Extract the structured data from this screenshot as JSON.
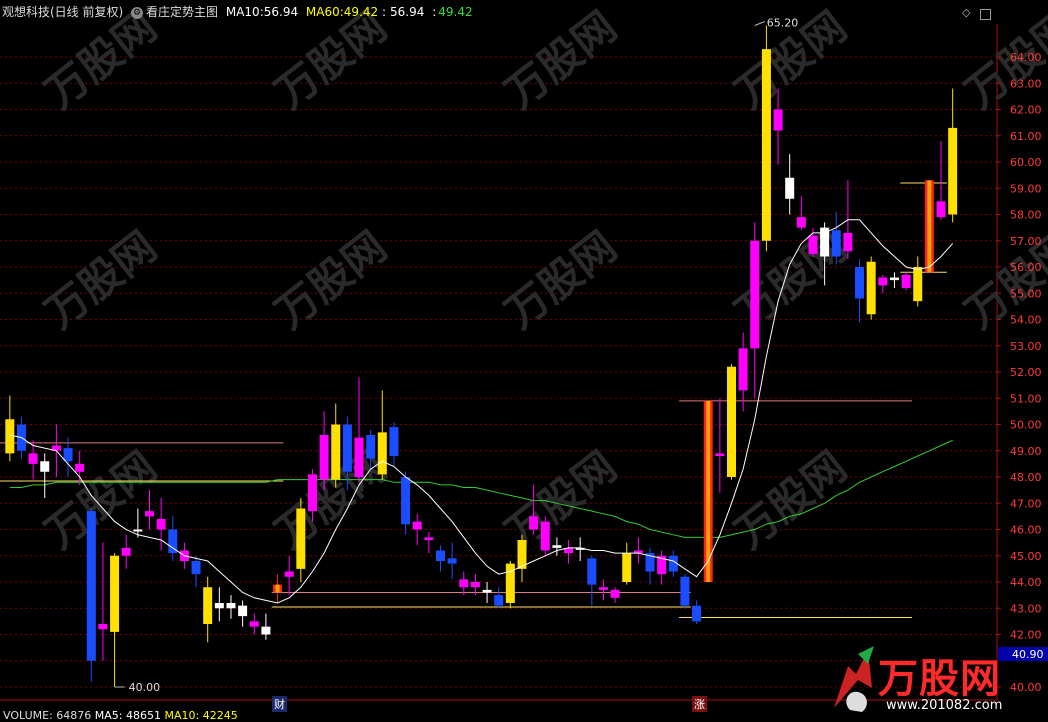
{
  "header": {
    "stock_name": "观想科技(日线 前复权)",
    "indicator_name": "看庄定势主图",
    "ma10_label": "MA10:",
    "ma10_value": "56.94",
    "ma60_label": "MA60:",
    "ma60_value": "49.42",
    "sep": ":",
    "extra_value_1": "56.94",
    "extra_value_2": "49.42"
  },
  "volume_bar": {
    "label": "VOLUME: 64876",
    "ma5": "MA5: 48651",
    "ma10": "MA10: 42245"
  },
  "markers": {
    "cai": "财",
    "zhang": "涨"
  },
  "price_labels": {
    "high": "65.20",
    "low": "40.00",
    "current": "40.90"
  },
  "watermark": {
    "brand": "万股网",
    "url": "www.201082.com"
  },
  "colors": {
    "up": "#ffe000",
    "down": "#1a4dff",
    "pink": "#ff00ff",
    "white": "#ffffff",
    "red": "#ff2020",
    "ma10": "#ffffff",
    "ma60": "#33cc33",
    "grid": "#7a0000"
  },
  "chart_data": {
    "type": "candlestick",
    "ylim": [
      40.0,
      65.2
    ],
    "yticks": [
      40.0,
      41.0,
      42.0,
      43.0,
      44.0,
      45.0,
      46.0,
      47.0,
      48.0,
      49.0,
      50.0,
      51.0,
      52.0,
      53.0,
      54.0,
      55.0,
      56.0,
      57.0,
      58.0,
      59.0,
      60.0,
      61.0,
      62.0,
      63.0,
      64.0
    ],
    "candles": [
      {
        "o": 48.9,
        "c": 50.2,
        "h": 51.1,
        "l": 48.6,
        "k": "up"
      },
      {
        "o": 50.0,
        "c": 49.0,
        "h": 50.3,
        "l": 48.7,
        "k": "down"
      },
      {
        "o": 48.9,
        "c": 48.5,
        "h": 49.4,
        "l": 47.9,
        "k": "pink"
      },
      {
        "o": 48.6,
        "c": 48.2,
        "h": 48.9,
        "l": 47.2,
        "k": "white"
      },
      {
        "o": 49.2,
        "c": 49.0,
        "h": 50.0,
        "l": 48.0,
        "k": "pink"
      },
      {
        "o": 49.1,
        "c": 48.6,
        "h": 49.5,
        "l": 48.0,
        "k": "down"
      },
      {
        "o": 48.5,
        "c": 48.2,
        "h": 49.0,
        "l": 47.7,
        "k": "pink"
      },
      {
        "o": 46.7,
        "c": 41.0,
        "h": 46.8,
        "l": 40.2,
        "k": "down"
      },
      {
        "o": 42.2,
        "c": 42.4,
        "h": 45.5,
        "l": 41.0,
        "k": "pink"
      },
      {
        "o": 42.1,
        "c": 45.0,
        "h": 45.1,
        "l": 40.0,
        "k": "up"
      },
      {
        "o": 45.0,
        "c": 45.3,
        "h": 45.8,
        "l": 44.5,
        "k": "pink"
      },
      {
        "o": 46.0,
        "c": 46.0,
        "h": 46.8,
        "l": 45.7,
        "k": "white"
      },
      {
        "o": 46.7,
        "c": 46.5,
        "h": 47.5,
        "l": 46.0,
        "k": "pink"
      },
      {
        "o": 46.4,
        "c": 46.0,
        "h": 47.2,
        "l": 45.2,
        "k": "pink"
      },
      {
        "o": 46.0,
        "c": 45.1,
        "h": 46.5,
        "l": 44.8,
        "k": "down"
      },
      {
        "o": 45.2,
        "c": 44.8,
        "h": 45.5,
        "l": 44.5,
        "k": "pink"
      },
      {
        "o": 44.8,
        "c": 44.3,
        "h": 45.0,
        "l": 43.8,
        "k": "down"
      },
      {
        "o": 42.4,
        "c": 43.8,
        "h": 44.2,
        "l": 41.7,
        "k": "up"
      },
      {
        "o": 43.2,
        "c": 43.0,
        "h": 43.8,
        "l": 42.5,
        "k": "white"
      },
      {
        "o": 43.2,
        "c": 43.0,
        "h": 43.5,
        "l": 42.6,
        "k": "white"
      },
      {
        "o": 42.7,
        "c": 43.1,
        "h": 43.3,
        "l": 42.3,
        "k": "white"
      },
      {
        "o": 42.5,
        "c": 42.3,
        "h": 42.8,
        "l": 42.0,
        "k": "pink"
      },
      {
        "o": 42.0,
        "c": 42.3,
        "h": 42.8,
        "l": 41.8,
        "k": "white"
      },
      {
        "o": 43.9,
        "c": 43.6,
        "h": 44.3,
        "l": 43.2,
        "k": "red"
      },
      {
        "o": 44.4,
        "c": 44.2,
        "h": 45.0,
        "l": 43.5,
        "k": "pink"
      },
      {
        "o": 44.5,
        "c": 46.8,
        "h": 47.2,
        "l": 44.0,
        "k": "up"
      },
      {
        "o": 46.7,
        "c": 48.1,
        "h": 48.3,
        "l": 46.3,
        "k": "pink"
      },
      {
        "o": 47.9,
        "c": 49.6,
        "h": 50.5,
        "l": 47.5,
        "k": "pink"
      },
      {
        "o": 47.9,
        "c": 50.0,
        "h": 50.8,
        "l": 47.6,
        "k": "up"
      },
      {
        "o": 50.0,
        "c": 48.2,
        "h": 50.3,
        "l": 47.5,
        "k": "down"
      },
      {
        "o": 48.0,
        "c": 49.5,
        "h": 51.8,
        "l": 47.8,
        "k": "pink"
      },
      {
        "o": 48.7,
        "c": 49.6,
        "h": 49.8,
        "l": 48.3,
        "k": "down"
      },
      {
        "o": 48.1,
        "c": 49.7,
        "h": 51.3,
        "l": 47.9,
        "k": "up"
      },
      {
        "o": 49.9,
        "c": 48.8,
        "h": 50.1,
        "l": 48.4,
        "k": "down"
      },
      {
        "o": 48.0,
        "c": 46.2,
        "h": 48.2,
        "l": 45.8,
        "k": "down"
      },
      {
        "o": 46.3,
        "c": 46.0,
        "h": 46.6,
        "l": 45.4,
        "k": "pink"
      },
      {
        "o": 45.7,
        "c": 45.6,
        "h": 45.9,
        "l": 45.1,
        "k": "pink"
      },
      {
        "o": 45.2,
        "c": 44.8,
        "h": 45.4,
        "l": 44.4,
        "k": "down"
      },
      {
        "o": 44.9,
        "c": 44.7,
        "h": 45.5,
        "l": 44.1,
        "k": "down"
      },
      {
        "o": 44.1,
        "c": 43.8,
        "h": 44.4,
        "l": 43.5,
        "k": "pink"
      },
      {
        "o": 43.8,
        "c": 44.0,
        "h": 44.3,
        "l": 43.5,
        "k": "pink"
      },
      {
        "o": 43.7,
        "c": 43.6,
        "h": 44.0,
        "l": 43.2,
        "k": "white"
      },
      {
        "o": 43.5,
        "c": 43.1,
        "h": 43.8,
        "l": 43.0,
        "k": "down"
      },
      {
        "o": 43.2,
        "c": 44.7,
        "h": 44.8,
        "l": 43.0,
        "k": "up"
      },
      {
        "o": 44.5,
        "c": 45.6,
        "h": 45.8,
        "l": 44.0,
        "k": "up"
      },
      {
        "o": 46.5,
        "c": 46.0,
        "h": 47.7,
        "l": 45.8,
        "k": "pink"
      },
      {
        "o": 46.3,
        "c": 45.2,
        "h": 46.5,
        "l": 45.0,
        "k": "pink"
      },
      {
        "o": 45.3,
        "c": 45.4,
        "h": 45.7,
        "l": 45.0,
        "k": "white"
      },
      {
        "o": 45.3,
        "c": 45.1,
        "h": 45.6,
        "l": 44.7,
        "k": "pink"
      },
      {
        "o": 45.3,
        "c": 45.3,
        "h": 45.7,
        "l": 44.8,
        "k": "white"
      },
      {
        "o": 44.9,
        "c": 43.9,
        "h": 45.0,
        "l": 43.1,
        "k": "down"
      },
      {
        "o": 43.7,
        "c": 43.8,
        "h": 44.1,
        "l": 43.3,
        "k": "pink"
      },
      {
        "o": 43.7,
        "c": 43.4,
        "h": 43.8,
        "l": 43.2,
        "k": "pink"
      },
      {
        "o": 44.0,
        "c": 45.1,
        "h": 45.5,
        "l": 43.9,
        "k": "up"
      },
      {
        "o": 45.2,
        "c": 45.1,
        "h": 45.7,
        "l": 44.7,
        "k": "pink"
      },
      {
        "o": 45.1,
        "c": 44.4,
        "h": 45.3,
        "l": 43.9,
        "k": "down"
      },
      {
        "o": 45.0,
        "c": 44.3,
        "h": 45.2,
        "l": 43.9,
        "k": "pink"
      },
      {
        "o": 45.0,
        "c": 44.4,
        "h": 45.2,
        "l": 44.2,
        "k": "down"
      },
      {
        "o": 44.2,
        "c": 43.1,
        "h": 44.3,
        "l": 43.0,
        "k": "down"
      },
      {
        "o": 43.1,
        "c": 42.5,
        "h": 43.3,
        "l": 42.4,
        "k": "down"
      },
      {
        "o": 44.0,
        "c": 50.9,
        "h": 50.9,
        "l": 44.0,
        "k": "red"
      },
      {
        "o": 48.9,
        "c": 48.8,
        "h": 51.0,
        "l": 47.4,
        "k": "pink"
      },
      {
        "o": 48.0,
        "c": 52.2,
        "h": 52.3,
        "l": 47.9,
        "k": "up"
      },
      {
        "o": 51.3,
        "c": 52.9,
        "h": 53.5,
        "l": 50.5,
        "k": "pink"
      },
      {
        "o": 52.9,
        "c": 57.0,
        "h": 57.7,
        "l": 51.0,
        "k": "pink"
      },
      {
        "o": 57.0,
        "c": 64.3,
        "h": 65.2,
        "l": 56.6,
        "k": "up"
      },
      {
        "o": 62.0,
        "c": 61.2,
        "h": 62.8,
        "l": 59.9,
        "k": "pink"
      },
      {
        "o": 59.4,
        "c": 58.6,
        "h": 60.3,
        "l": 58.0,
        "k": "white"
      },
      {
        "o": 57.9,
        "c": 57.5,
        "h": 58.7,
        "l": 57.4,
        "k": "pink"
      },
      {
        "o": 57.2,
        "c": 56.5,
        "h": 57.5,
        "l": 56.4,
        "k": "pink"
      },
      {
        "o": 56.4,
        "c": 57.5,
        "h": 57.7,
        "l": 55.3,
        "k": "white"
      },
      {
        "o": 57.4,
        "c": 56.4,
        "h": 58.1,
        "l": 56.1,
        "k": "down"
      },
      {
        "o": 57.3,
        "c": 56.6,
        "h": 59.3,
        "l": 56.3,
        "k": "pink"
      },
      {
        "o": 56.0,
        "c": 54.8,
        "h": 56.3,
        "l": 53.9,
        "k": "down"
      },
      {
        "o": 54.2,
        "c": 56.2,
        "h": 56.4,
        "l": 54.0,
        "k": "up"
      },
      {
        "o": 55.6,
        "c": 55.3,
        "h": 55.7,
        "l": 55.0,
        "k": "pink"
      },
      {
        "o": 55.6,
        "c": 55.5,
        "h": 55.8,
        "l": 55.2,
        "k": "white"
      },
      {
        "o": 55.7,
        "c": 55.2,
        "h": 55.8,
        "l": 55.1,
        "k": "pink"
      },
      {
        "o": 56.0,
        "c": 54.7,
        "h": 56.4,
        "l": 54.5,
        "k": "up"
      },
      {
        "o": 55.8,
        "c": 59.3,
        "h": 59.3,
        "l": 55.8,
        "k": "red"
      },
      {
        "o": 58.5,
        "c": 57.9,
        "h": 60.8,
        "l": 57.8,
        "k": "pink"
      },
      {
        "o": 58.0,
        "c": 61.3,
        "h": 62.8,
        "l": 57.7,
        "k": "up"
      }
    ],
    "ma10": [
      49.6,
      49.5,
      49.2,
      49.1,
      49.0,
      48.5,
      48.0,
      47.3,
      46.8,
      46.3,
      46.0,
      45.8,
      45.7,
      45.6,
      45.3,
      45.0,
      44.9,
      44.8,
      44.4,
      44.0,
      43.6,
      43.4,
      43.3,
      43.2,
      43.4,
      43.8,
      44.4,
      45.1,
      46.0,
      46.8,
      47.7,
      48.3,
      48.6,
      48.4,
      48.0,
      47.7,
      47.3,
      46.8,
      46.3,
      45.7,
      45.1,
      44.6,
      44.3,
      44.4,
      44.6,
      44.8,
      45.0,
      45.2,
      45.3,
      45.3,
      45.2,
      45.2,
      45.1,
      45.1,
      45.1,
      45.0,
      44.9,
      44.8,
      44.5,
      44.2,
      44.8,
      45.8,
      47.0,
      48.3,
      50.2,
      52.6,
      54.7,
      56.1,
      56.9,
      57.3,
      57.3,
      57.5,
      57.8,
      57.8,
      57.3,
      56.8,
      56.4,
      56.0,
      55.9,
      56.0,
      56.4,
      56.9
    ],
    "ma60": [
      47.6,
      47.6,
      47.7,
      47.7,
      47.8,
      47.8,
      47.8,
      47.8,
      47.8,
      47.8,
      47.8,
      47.8,
      47.8,
      47.8,
      47.8,
      47.8,
      47.8,
      47.8,
      47.8,
      47.8,
      47.8,
      47.8,
      47.8,
      47.9,
      47.9,
      47.9,
      47.9,
      47.9,
      47.9,
      47.9,
      47.9,
      47.9,
      47.9,
      47.8,
      47.8,
      47.8,
      47.8,
      47.7,
      47.7,
      47.6,
      47.6,
      47.5,
      47.4,
      47.3,
      47.2,
      47.1,
      47.1,
      47.0,
      46.9,
      46.8,
      46.7,
      46.6,
      46.5,
      46.3,
      46.2,
      46.0,
      45.9,
      45.8,
      45.7,
      45.7,
      45.7,
      45.7,
      45.8,
      45.9,
      46.0,
      46.2,
      46.3,
      46.5,
      46.6,
      46.8,
      47.0,
      47.3,
      47.5,
      47.8,
      48.0,
      48.2,
      48.4,
      48.6,
      48.8,
      49.0,
      49.2,
      49.4
    ],
    "hlines": [
      {
        "y": 49.3,
        "from": 0,
        "to": 23,
        "color": "#e07a7a"
      },
      {
        "y": 47.85,
        "from": 0,
        "to": 23,
        "color": "#ffe060"
      },
      {
        "y": 43.6,
        "from": 23,
        "to": 58,
        "color": "#e07a7a"
      },
      {
        "y": 43.05,
        "from": 23,
        "to": 58,
        "color": "#ffe060"
      },
      {
        "y": 50.9,
        "from": 58,
        "to": 77,
        "color": "#e07a7a"
      },
      {
        "y": 42.65,
        "from": 58,
        "to": 77,
        "color": "#ffe060"
      },
      {
        "y": 59.2,
        "from": 77,
        "to": 80,
        "color": "#ffe060"
      },
      {
        "y": 55.8,
        "from": 77,
        "to": 80,
        "color": "#ffe060"
      }
    ]
  }
}
